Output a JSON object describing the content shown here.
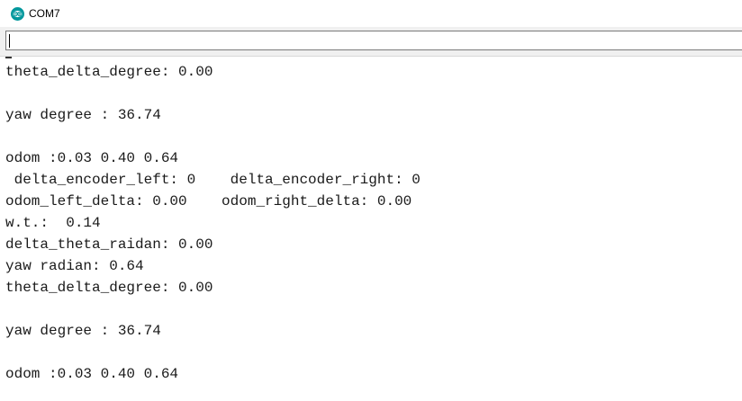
{
  "window": {
    "title": "COM7",
    "icon": "arduino-logo-icon",
    "accent": "#00979c"
  },
  "send_bar": {
    "value": "",
    "placeholder": ""
  },
  "serial_output": {
    "lines": [
      "theta_delta_degree: 0.00",
      "",
      "yaw degree : 36.74",
      "",
      "odom :0.03 0.40 0.64",
      " delta_encoder_left: 0    delta_encoder_right: 0",
      "odom_left_delta: 0.00    odom_right_delta: 0.00",
      "w.t.:  0.14",
      "delta_theta_raidan: 0.00",
      "yaw radian: 0.64",
      "theta_delta_degree: 0.00",
      "",
      "yaw degree : 36.74",
      "",
      "odom :0.03 0.40 0.64"
    ]
  }
}
